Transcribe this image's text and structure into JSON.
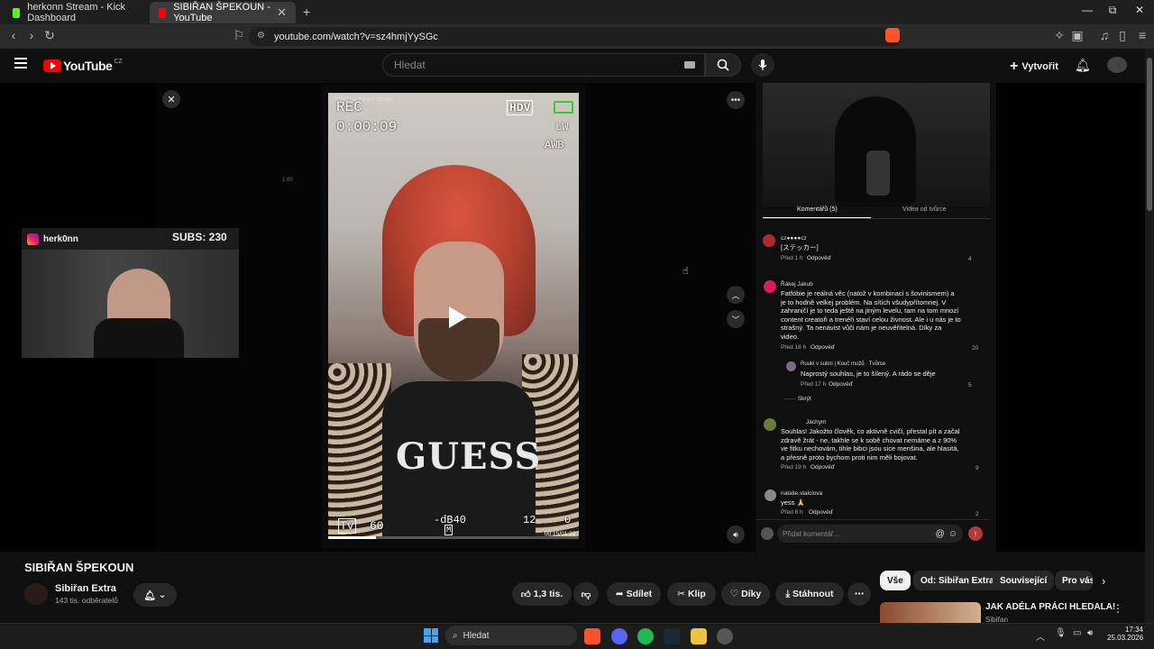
{
  "browser": {
    "tabs": [
      {
        "title": "herkonn Stream - Kick Dashboard",
        "color": "#53fc18"
      },
      {
        "title": "SIBIŘAN ŠPEKOUN - YouTube",
        "color": "#ff0000"
      }
    ],
    "new_tab": "+",
    "url": "youtube.com/watch?v=sz4hmjYySGc",
    "window_controls": [
      "—",
      "⧉",
      "✕"
    ]
  },
  "youtube": {
    "logo_text": "YouTube",
    "region": "CZ",
    "search_placeholder": "Hledat",
    "create_label": "Vytvořit"
  },
  "video": {
    "close_label": "✕",
    "similar_label": "Najít podobný obsah",
    "rec": "REC",
    "timecode": "0:00:09",
    "hdv": "HDV",
    "lw": "LW",
    "awb": "AWB",
    "shirt_text": "GUESS",
    "tv": "Tv",
    "tv_num": "60",
    "db": "-dB40",
    "m": "M",
    "n12": "12",
    "n0": "0",
    "duration": "00:15/01:22",
    "side_number": "1:00",
    "progress": 0.19
  },
  "webcam": {
    "handle": "herk0nn",
    "subs": "SUBS: 230"
  },
  "comments_panel": {
    "tabs": [
      "Komentářů (5)",
      "Videa od tvůrce"
    ],
    "comments": [
      {
        "author": "cz●●●●cz",
        "text": "[ステッカー]",
        "time": "Před 1 h",
        "reply": "Odpověď",
        "likes": "4",
        "avatar": "#b02a2a"
      },
      {
        "author": "Řákej Jakub",
        "text": "Fatfóbie je reálná věc (natož v kombinaci s šovinismem) a je to hodně velkej problém. Na sítích všudypřítomnej. V zahraničí je to teda ještě na jiným levelu, tam na tom mnozí content creatoři a trenéři staví celou živnost. Ale i u nás je to strašný. Ta nenávist vůči nám je neuvěřitelná. Díky za video.",
        "time": "Před 18 h",
        "reply": "Odpověď",
        "likes": "20",
        "avatar": "#d81b60"
      },
      {
        "author": "Ruuki v sukni | Kouč mužů · Tvůrce",
        "text": "Naprostý souhlas, je to šílený. A rádo se děje",
        "time": "Před 17 h",
        "reply": "Odpověď",
        "likes": "5",
        "avatar": "#7a6a8a"
      },
      {
        "author": "Jáchym",
        "text": "Souhlas! Jakožto člověk, co aktivně cvičí, přestal pít a začal zdravě žrát - ne, takhle se k sobě chovat nemáme a z 90% ve fitku nechovám, tihle bibci jsou sice menšina, ale hlasitá, a přesně proto bychom proti nim měli bojovat.",
        "time": "Před 19 h",
        "reply": "Odpověď",
        "likes": "9",
        "avatar": "#6b7a3a"
      },
      {
        "author": "natalie.stalclova",
        "text": "yess 🙏",
        "time": "Před 8 h",
        "reply": "Odpověď",
        "likes": "2",
        "avatar": "#888888"
      }
    ],
    "hide_replies": "Skrýt",
    "add_comment_placeholder": "Přidat komentář..."
  },
  "below": {
    "title": "SIBIŘAN ŠPEKOUN",
    "channel": "Sibiřan Extra",
    "subscribers": "143 tis. odběratelů",
    "likes": "1,3 tis.",
    "share": "Sdílet",
    "clip": "Klip",
    "thanks": "Díky",
    "download": "Stáhnout",
    "chips": [
      "Vše",
      "Od: Sibiřan Extra",
      "Související",
      "Pro vás"
    ],
    "rec_title": "JAK ADÉLA PRÁCI HLEDALA!",
    "rec_channel": "Sibiřan"
  },
  "taskbar": {
    "search": "Hledat",
    "time": "17:34",
    "date": "25.03.2026"
  }
}
